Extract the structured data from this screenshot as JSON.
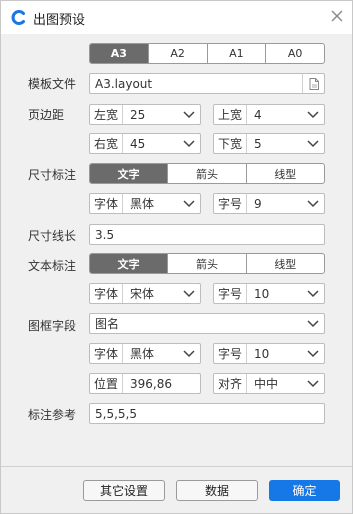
{
  "window": {
    "title": "出图预设"
  },
  "paper_sizes": [
    "A3",
    "A2",
    "A1",
    "A0"
  ],
  "paper_selected": "A3",
  "template": {
    "label": "模板文件",
    "value": "A3.layout"
  },
  "margins": {
    "label": "页边距",
    "left": {
      "prefix": "左宽",
      "value": "25"
    },
    "top": {
      "prefix": "上宽",
      "value": "4"
    },
    "right": {
      "prefix": "右宽",
      "value": "45"
    },
    "bottom": {
      "prefix": "下宽",
      "value": "5"
    }
  },
  "dim_annotation": {
    "label": "尺寸标注",
    "modes": [
      "文字",
      "箭头",
      "线型"
    ],
    "selected": "文字",
    "font_prefix": "字体",
    "font_value": "黑体",
    "size_prefix": "字号",
    "size_value": "9"
  },
  "dim_line_length": {
    "label": "尺寸线长",
    "value": "3.5"
  },
  "text_annotation": {
    "label": "文本标注",
    "modes": [
      "文字",
      "箭头",
      "线型"
    ],
    "selected": "文字",
    "font_prefix": "字体",
    "font_value": "宋体",
    "size_prefix": "字号",
    "size_value": "10"
  },
  "frame_field": {
    "label": "图框字段",
    "value": "图名",
    "font_prefix": "字体",
    "font_value": "黑体",
    "size_prefix": "字号",
    "size_value": "10",
    "pos_prefix": "位置",
    "pos_value": "396,86",
    "align_prefix": "对齐",
    "align_value": "中中"
  },
  "annotation_ref": {
    "label": "标注参考",
    "value": "5,5,5,5"
  },
  "buttons": {
    "other_settings": "其它设置",
    "data": "数据",
    "ok": "确定"
  },
  "colors": {
    "primary": "#1677e6",
    "selected_segment": "#6b6b6b"
  }
}
